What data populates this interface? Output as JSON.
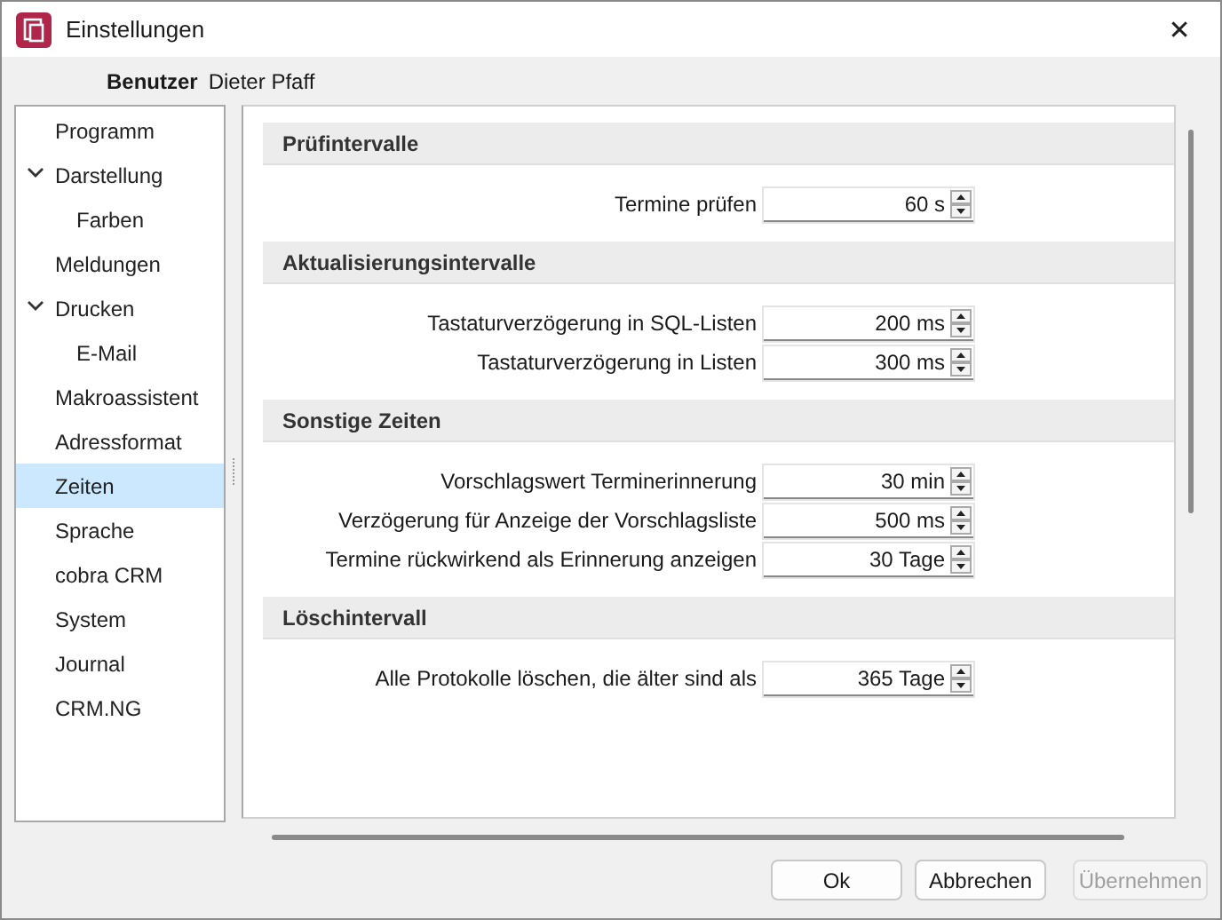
{
  "window": {
    "title": "Einstellungen",
    "close": "✕"
  },
  "user": {
    "label": "Benutzer",
    "value": "Dieter Pfaff"
  },
  "sidebar": {
    "items": [
      {
        "label": "Programm",
        "selected": false
      },
      {
        "label": "Darstellung",
        "selected": false,
        "expanded": true,
        "children": [
          {
            "label": "Farben",
            "selected": false
          }
        ]
      },
      {
        "label": "Meldungen",
        "selected": false
      },
      {
        "label": "Drucken",
        "selected": false,
        "expanded": true,
        "children": [
          {
            "label": "E-Mail",
            "selected": false
          }
        ]
      },
      {
        "label": "Makroassistent",
        "selected": false
      },
      {
        "label": "Adressformat",
        "selected": false
      },
      {
        "label": "Zeiten",
        "selected": true
      },
      {
        "label": "Sprache",
        "selected": false
      },
      {
        "label": "cobra CRM",
        "selected": false
      },
      {
        "label": "System",
        "selected": false
      },
      {
        "label": "Journal",
        "selected": false
      },
      {
        "label": "CRM.NG",
        "selected": false
      }
    ]
  },
  "sections": [
    {
      "title": "Prüfintervalle",
      "fields": [
        {
          "label": "Termine prüfen",
          "value": "60 s"
        }
      ]
    },
    {
      "title": "Aktualisierungsintervalle",
      "fields": [
        {
          "label": "Tastaturverzögerung in SQL-Listen",
          "value": "200 ms"
        },
        {
          "label": "Tastaturverzögerung in Listen",
          "value": "300 ms"
        }
      ]
    },
    {
      "title": "Sonstige Zeiten",
      "fields": [
        {
          "label": "Vorschlagswert Terminerinnerung",
          "value": "30 min"
        },
        {
          "label": "Verzögerung für Anzeige der Vorschlagsliste",
          "value": "500 ms"
        },
        {
          "label": "Termine rückwirkend als Erinnerung anzeigen",
          "value": "30 Tage"
        }
      ]
    },
    {
      "title": "Löschintervall",
      "fields": [
        {
          "label": "Alle Protokolle löschen, die älter sind als",
          "value": "365 Tage"
        }
      ]
    }
  ],
  "buttons": [
    {
      "label": "Ok",
      "disabled": false
    },
    {
      "label": "Abbrechen",
      "disabled": false
    },
    {
      "label": "Übernehmen",
      "disabled": true
    }
  ]
}
